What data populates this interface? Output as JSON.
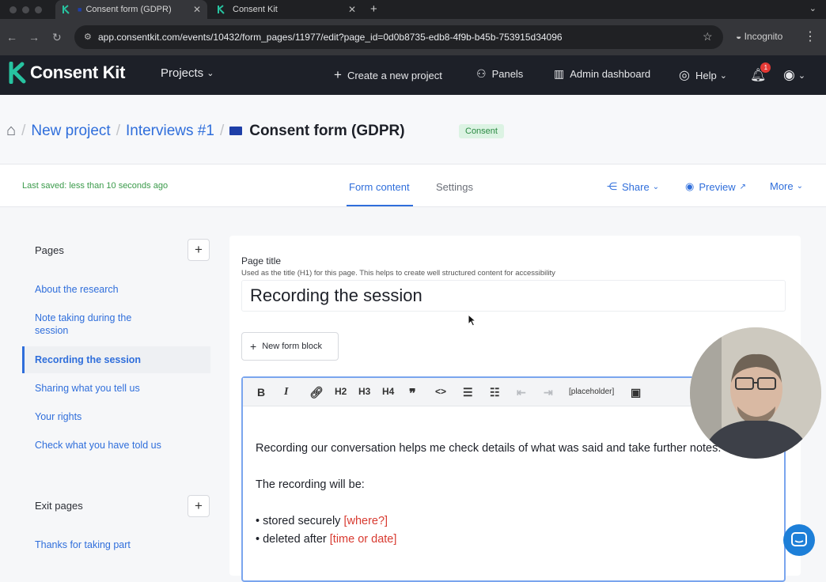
{
  "browser": {
    "tabs": [
      {
        "title": "Consent form (GDPR)",
        "active": true
      },
      {
        "title": "Consent Kit",
        "active": false
      }
    ],
    "url": "app.consentkit.com/events/10432/form_pages/11977/edit?page_id=0d0b8735-edb8-4f9b-b45b-753915d34096",
    "incognito_label": "Incognito"
  },
  "header": {
    "brand": "Consent Kit",
    "projects_label": "Projects",
    "create_label": "Create a new project",
    "panels_label": "Panels",
    "admin_label": "Admin dashboard",
    "help_label": "Help",
    "notification_count": "1"
  },
  "breadcrumb": {
    "items": [
      "New project",
      "Interviews #1"
    ],
    "current": "Consent form (GDPR)",
    "badge": "Consent"
  },
  "form_tabs": {
    "saved_status": "Last saved: less than 10 seconds ago",
    "tabs": [
      "Form content",
      "Settings"
    ],
    "active_tab": "Form content",
    "share_label": "Share",
    "preview_label": "Preview",
    "more_label": "More"
  },
  "sidebar": {
    "pages_title": "Pages",
    "pages": [
      "About the research",
      "Note taking during the session",
      "Recording the session",
      "Sharing what you tell us",
      "Your rights",
      "Check what you have told us"
    ],
    "active_page": "Recording the session",
    "exit_title": "Exit pages",
    "exit_pages": [
      "Thanks for taking part"
    ]
  },
  "editor": {
    "page_title_label": "Page title",
    "page_title_help": "Used as the title (H1) for this page. This helps to create well structured content for accessibility",
    "page_title_value": "Recording the session",
    "new_block_label": "New form block",
    "toolbar": [
      "B",
      "I",
      "link",
      "H2",
      "H3",
      "H4",
      "quote",
      "code",
      "bullet-list",
      "number-list",
      "outdent",
      "indent",
      "[placeholder]",
      "image"
    ],
    "placeholder_button": "[placeholder]",
    "body_p1": "Recording our conversation helps me check details of what was said and take further notes.",
    "body_p2": "The recording will be:",
    "bullet1_text": "stored securely ",
    "bullet1_ph": "[where?]",
    "bullet2_text": "deleted after ",
    "bullet2_ph": "[time or date]"
  },
  "colors": {
    "accent": "#2f6edb",
    "header_bg": "#1d2028",
    "saved_green": "#3a9a4a",
    "placeholder_red": "#d83a30"
  }
}
